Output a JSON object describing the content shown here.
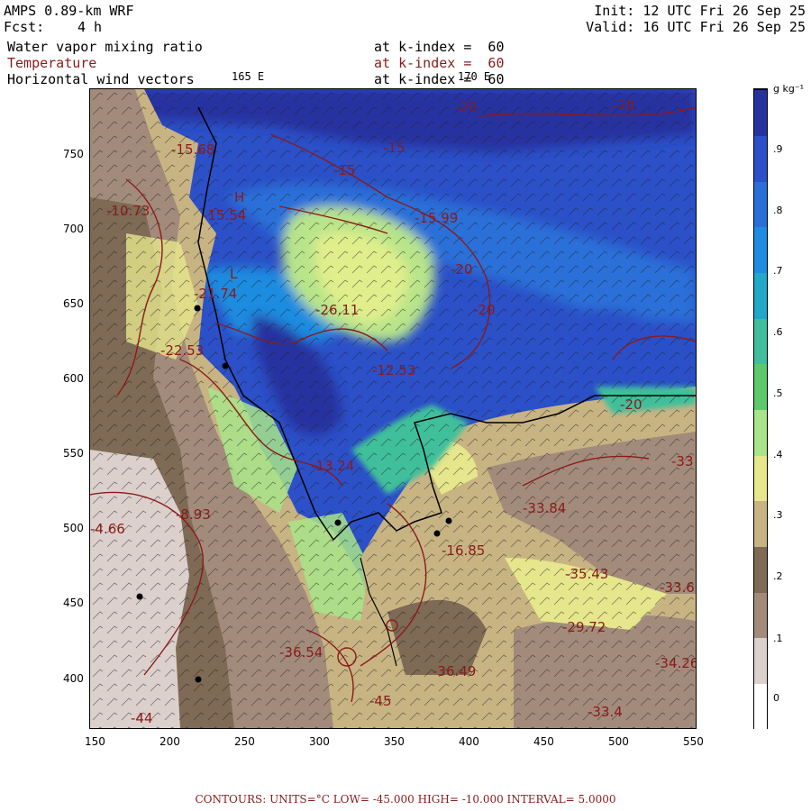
{
  "header": {
    "model": "AMPS 0.89-km WRF",
    "forecast_label": "Fcst:",
    "forecast_value": "4 h",
    "init": "Init: 12 UTC Fri 26 Sep 25",
    "valid": "Valid: 16 UTC Fri 26 Sep 25"
  },
  "fields": [
    {
      "name": "Water vapor mixing ratio",
      "level": "at k-index =  60",
      "color": "#000000"
    },
    {
      "name": "Temperature",
      "level": "at k-index =  60",
      "color": "#8b1a1a"
    },
    {
      "name": "Horizontal wind vectors",
      "level": "at k-index =  60",
      "color": "#000000"
    }
  ],
  "longitude_labels": [
    "165 E",
    "170 E"
  ],
  "x_ticks": [
    "150",
    "200",
    "250",
    "300",
    "350",
    "400",
    "450",
    "500",
    "550"
  ],
  "y_ticks": [
    "400",
    "450",
    "500",
    "550",
    "600",
    "650",
    "700",
    "750"
  ],
  "colorbar": {
    "units": "g kg⁻¹",
    "labels": [
      "0",
      ".1",
      ".2",
      ".3",
      ".4",
      ".5",
      ".6",
      ".7",
      ".8",
      ".9"
    ],
    "colors": [
      "#ffffff",
      "#dcd0cc",
      "#a28b7b",
      "#7e6a55",
      "#c8b483",
      "#e6e68c",
      "#a8e48a",
      "#5cc96a",
      "#3fbf9b",
      "#22a8c9",
      "#1e8ce0",
      "#2a6fd8",
      "#2b50c8",
      "#26339f"
    ]
  },
  "contour_labels": [
    {
      "text": "-20",
      "color": "#8b1a1a"
    },
    {
      "text": "-20",
      "color": "#8b1a1a"
    },
    {
      "text": "-15",
      "color": "#8b1a1a"
    },
    {
      "text": "-15",
      "color": "#8b1a1a"
    },
    {
      "text": "-15.68",
      "color": "#8b1a1a"
    },
    {
      "text": "-15.54",
      "color": "#8b1a1a"
    },
    {
      "text": "-15.99",
      "color": "#8b1a1a"
    },
    {
      "text": "-20",
      "color": "#8b1a1a"
    },
    {
      "text": "-20",
      "color": "#8b1a1a"
    },
    {
      "text": "-21.74",
      "color": "#8b1a1a"
    },
    {
      "text": "-26.11",
      "color": "#8b1a1a"
    },
    {
      "text": "-22.53",
      "color": "#8b1a1a"
    },
    {
      "text": "-12.53",
      "color": "#8b1a1a"
    },
    {
      "text": "-20",
      "color": "#8b1a1a"
    },
    {
      "text": "-33",
      "color": "#8b1a1a"
    },
    {
      "text": "-33.84",
      "color": "#8b1a1a"
    },
    {
      "text": "-35.43",
      "color": "#8b1a1a"
    },
    {
      "text": "-33.6",
      "color": "#8b1a1a"
    },
    {
      "text": "-29.72",
      "color": "#8b1a1a"
    },
    {
      "text": "-34.26",
      "color": "#8b1a1a"
    },
    {
      "text": "-33.4",
      "color": "#8b1a1a"
    },
    {
      "text": "-36.49",
      "color": "#8b1a1a"
    },
    {
      "text": "-36.54",
      "color": "#8b1a1a"
    },
    {
      "text": "-13.24",
      "color": "#8b1a1a"
    },
    {
      "text": "-16.85",
      "color": "#8b1a1a"
    },
    {
      "text": "-4.66",
      "color": "#8b1a1a"
    },
    {
      "text": "-8.93",
      "color": "#8b1a1a"
    },
    {
      "text": "-10.73",
      "color": "#8b1a1a"
    },
    {
      "text": "-45",
      "color": "#8b1a1a"
    },
    {
      "text": "-44",
      "color": "#8b1a1a"
    },
    {
      "text": "H",
      "color": "#8b1a1a"
    },
    {
      "text": "L",
      "color": "#8b1a1a"
    }
  ],
  "footer": "CONTOURS:  UNITS=°C  LOW= -45.000     HIGH= -10.000     INTERVAL=   5.0000"
}
